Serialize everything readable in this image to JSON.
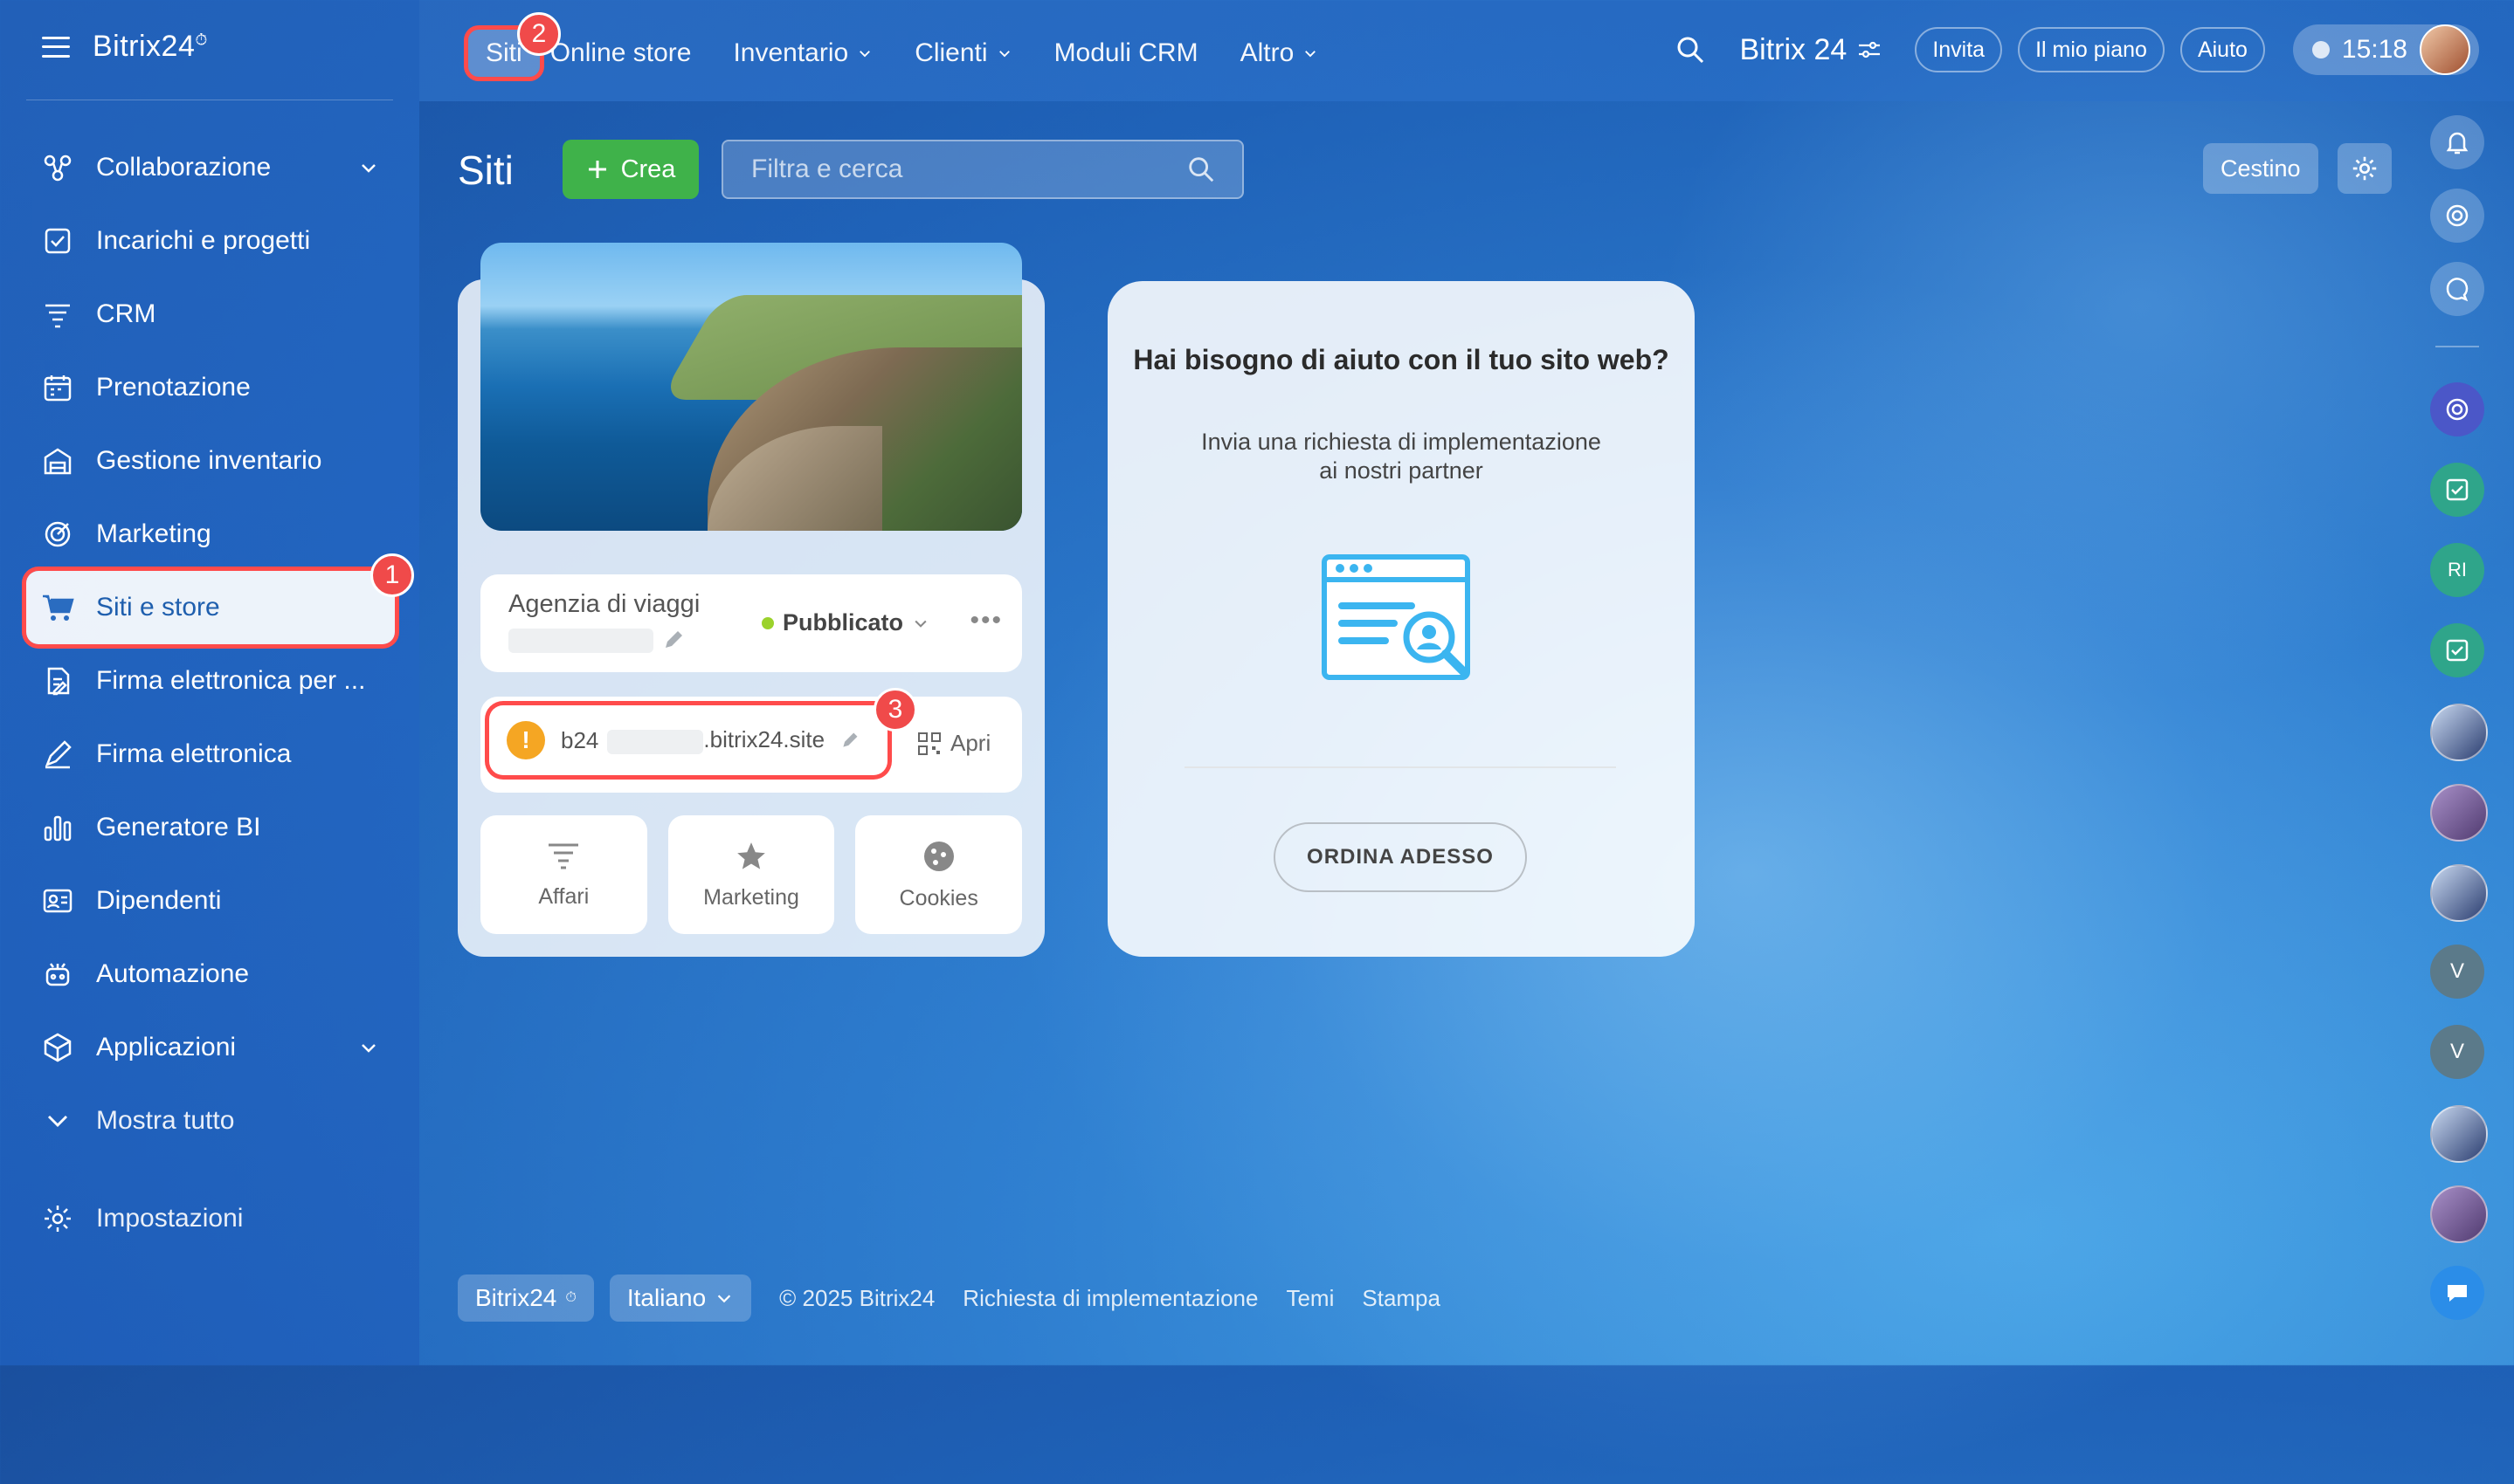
{
  "brand": {
    "name": "Bitrix24",
    "mark": "⏱"
  },
  "sidebar": {
    "items": [
      {
        "label": "Collaborazione",
        "icon": "collaboration-icon",
        "has_chevron": true
      },
      {
        "label": "Incarichi e progetti",
        "icon": "tasks-icon"
      },
      {
        "label": "CRM",
        "icon": "crm-icon"
      },
      {
        "label": "Prenotazione",
        "icon": "booking-icon"
      },
      {
        "label": "Gestione inventario",
        "icon": "inventory-icon"
      },
      {
        "label": "Marketing",
        "icon": "marketing-icon"
      },
      {
        "label": "Siti e store",
        "icon": "cart-icon",
        "active": true,
        "badge": "1"
      },
      {
        "label": "Firma elettronica per ...",
        "icon": "e-sign-hr-icon"
      },
      {
        "label": "Firma elettronica",
        "icon": "e-sign-icon"
      },
      {
        "label": "Generatore BI",
        "icon": "bi-icon"
      },
      {
        "label": "Dipendenti",
        "icon": "employees-icon"
      },
      {
        "label": "Automazione",
        "icon": "automation-icon"
      },
      {
        "label": "Applicazioni",
        "icon": "apps-icon",
        "has_chevron": true
      }
    ],
    "show_all": "Mostra tutto",
    "settings": "Impostazioni"
  },
  "topnav": {
    "items": [
      {
        "label": "Siti",
        "badge": "2"
      },
      {
        "label": "Online store"
      },
      {
        "label": "Inventario",
        "dropdown": true
      },
      {
        "label": "Clienti",
        "dropdown": true
      },
      {
        "label": "Moduli CRM"
      },
      {
        "label": "Altro",
        "dropdown": true
      }
    ],
    "brand": "Bitrix 24",
    "invite": "Invita",
    "plan": "Il mio piano",
    "help": "Aiuto",
    "time": "15:18"
  },
  "page": {
    "title": "Siti",
    "create_label": "Crea",
    "search_placeholder": "Filtra e cerca",
    "trash_label": "Cestino"
  },
  "site": {
    "name": "Agenzia di viaggi",
    "status": "Pubblicato",
    "url_prefix": "b24",
    "url_suffix": ".bitrix24.site",
    "url_badge": "3",
    "open_label": "Apri",
    "tiles": [
      {
        "label": "Affari",
        "icon": "funnel-icon"
      },
      {
        "label": "Marketing",
        "icon": "star-icon"
      },
      {
        "label": "Cookies",
        "icon": "cookie-icon"
      }
    ]
  },
  "help": {
    "title": "Hai bisogno di aiuto con il tuo sito web?",
    "text": "Invia una richiesta di implementazione ai nostri partner",
    "button": "ORDINA ADESSO"
  },
  "rail": {
    "initials_ri": "RI",
    "initials_v": "V"
  },
  "footer": {
    "brand": "Bitrix24",
    "language": "Italiano",
    "copyright": "© 2025 Bitrix24",
    "links": [
      "Richiesta di implementazione",
      "Temi",
      "Stampa"
    ]
  },
  "colors": {
    "accent_green": "#3fb24a",
    "highlight_red": "#ff4b4b",
    "status_green": "#9bd22c",
    "warning": "#f5a623"
  }
}
